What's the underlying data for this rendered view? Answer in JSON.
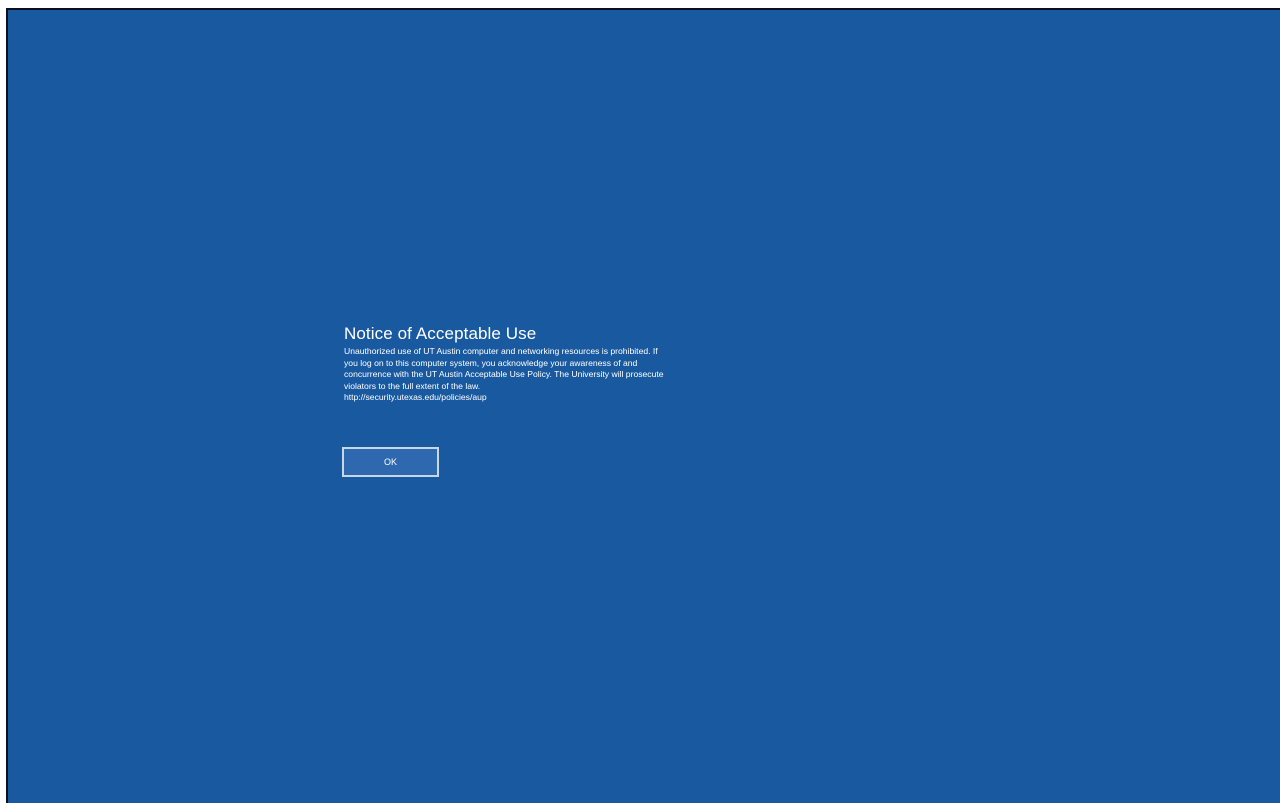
{
  "notice": {
    "title": "Notice of Acceptable Use",
    "body_lines": [
      "Unauthorized use of UT Austin computer and networking resources is prohibited. If",
      "you log on to this computer system, you acknowledge your awareness of and",
      "concurrence with the UT Austin Acceptable Use Policy. The University will prosecute",
      "violators to the full extent of the law.",
      "http://security.utexas.edu/policies/aup"
    ]
  },
  "actions": {
    "ok_label": "OK"
  },
  "colors": {
    "background": "#1859a0",
    "button_fill": "#2e69b0",
    "button_border": "#c9d6e6",
    "text": "#ffffff"
  }
}
